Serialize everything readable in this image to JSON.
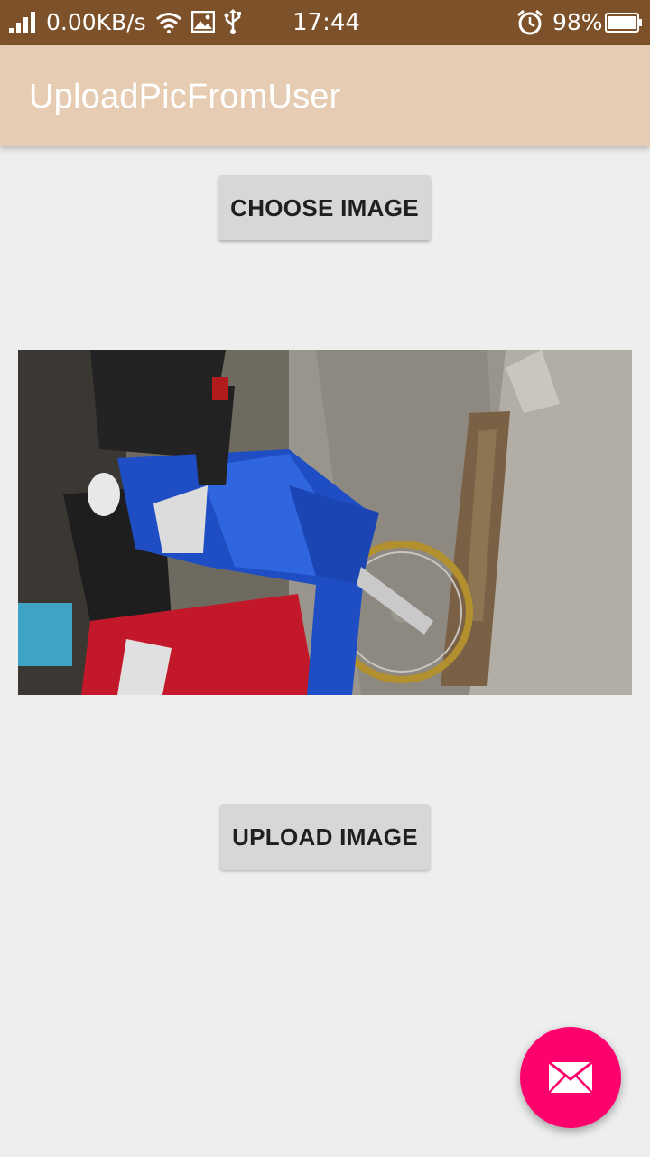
{
  "status_bar": {
    "network_speed": "0.00KB/s",
    "time": "17:44",
    "battery_percent": "98%",
    "icons": [
      "signal-icon",
      "wifi-icon",
      "gallery-icon",
      "usb-icon",
      "alarm-icon",
      "battery-icon"
    ]
  },
  "app_bar": {
    "title": "UploadPicFromUser",
    "background_color": "#e5ccb2"
  },
  "actions": {
    "choose_label": "CHOOSE IMAGE",
    "upload_label": "UPLOAD IMAGE"
  },
  "preview": {
    "image_subject": "blue motorcycle photo"
  },
  "fab": {
    "icon": "mail-icon",
    "color": "#fd026c"
  },
  "colors": {
    "status_bar": "#7d522a",
    "background": "#eeeeee",
    "button": "#d6d7d7"
  }
}
